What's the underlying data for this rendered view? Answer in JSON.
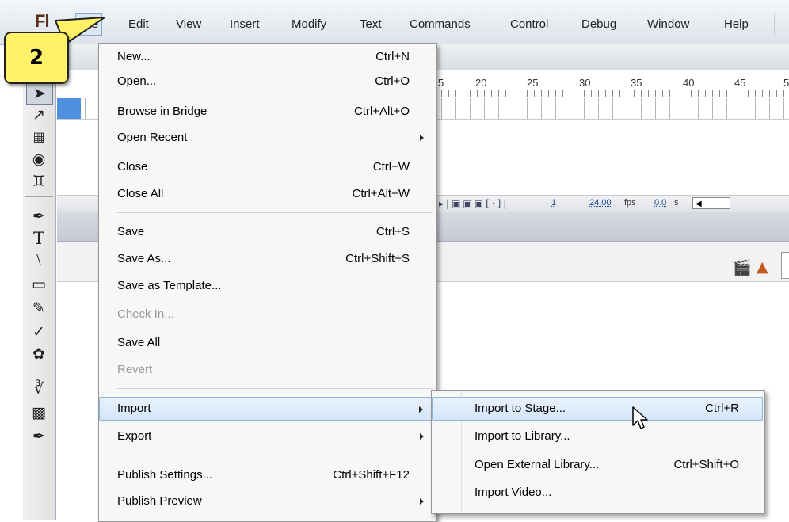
{
  "app": {
    "logo": "Fl"
  },
  "menubar": {
    "items": [
      "File",
      "Edit",
      "View",
      "Insert",
      "Modify",
      "Text",
      "Commands",
      "Control",
      "Debug",
      "Window",
      "Help"
    ]
  },
  "callout": {
    "number": "2"
  },
  "timeline": {
    "ruler_numbers": [
      "5",
      "20",
      "25",
      "30",
      "35",
      "40",
      "45",
      "5"
    ],
    "current_frame": "1",
    "fps": "24.00",
    "fps_unit": "fps",
    "elapsed": "0.0",
    "elapsed_unit": "s"
  },
  "file_menu": {
    "items": [
      {
        "label": "New...",
        "shortcut": "Ctrl+N"
      },
      {
        "label": "Open...",
        "shortcut": "Ctrl+O"
      },
      {
        "label": "Browse in Bridge",
        "shortcut": "Ctrl+Alt+O"
      },
      {
        "label": "Open Recent",
        "shortcut": "",
        "submenu": true
      },
      {
        "label": "Close",
        "shortcut": "Ctrl+W"
      },
      {
        "label": "Close All",
        "shortcut": "Ctrl+Alt+W"
      },
      {
        "label": "Save",
        "shortcut": "Ctrl+S"
      },
      {
        "label": "Save As...",
        "shortcut": "Ctrl+Shift+S"
      },
      {
        "label": "Save as Template...",
        "shortcut": ""
      },
      {
        "label": "Check In...",
        "shortcut": "",
        "disabled": true
      },
      {
        "label": "Save All",
        "shortcut": ""
      },
      {
        "label": "Revert",
        "shortcut": "",
        "disabled": true
      },
      {
        "label": "Import",
        "shortcut": "",
        "submenu": true,
        "highlighted": true
      },
      {
        "label": "Export",
        "shortcut": "",
        "submenu": true
      },
      {
        "label": "Publish Settings...",
        "shortcut": "Ctrl+Shift+F12"
      },
      {
        "label": "Publish Preview",
        "shortcut": "",
        "submenu": true
      }
    ]
  },
  "import_menu": {
    "items": [
      {
        "label": "Import to Stage...",
        "shortcut": "Ctrl+R",
        "highlighted": true
      },
      {
        "label": "Import to Library...",
        "shortcut": ""
      },
      {
        "label": "Open External Library...",
        "shortcut": "Ctrl+Shift+O"
      },
      {
        "label": "Import Video...",
        "shortcut": ""
      }
    ]
  },
  "toolbar": {
    "tools": [
      "selection-tool",
      "subselection-tool",
      "free-transform-tool",
      "3d-rotation-tool",
      "lasso-tool",
      "pen-tool",
      "text-tool",
      "line-tool",
      "rectangle-tool",
      "pencil-tool",
      "brush-tool",
      "deco-tool",
      "bone-tool",
      "paint-bucket-tool",
      "eyedropper-tool"
    ]
  }
}
